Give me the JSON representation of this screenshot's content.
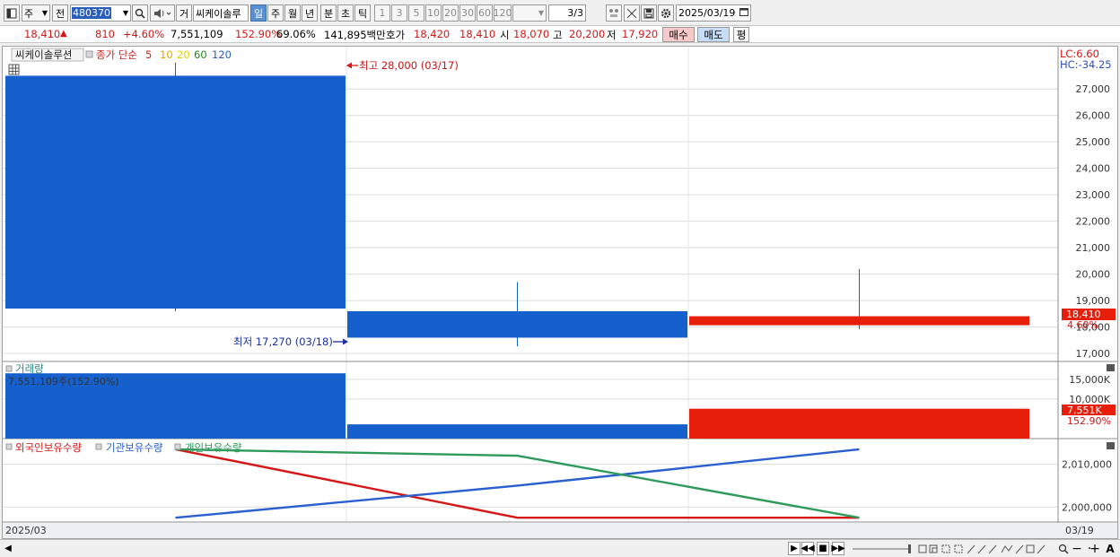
{
  "toolbar": {
    "market_label": "주",
    "prev_label": "전",
    "code": "480370",
    "geo_label": "거",
    "stock_name": "씨케이솔루",
    "periods": [
      "일",
      "주",
      "월",
      "년",
      "분",
      "초",
      "틱"
    ],
    "active_period": "일",
    "intervals": [
      "1",
      "3",
      "5",
      "10",
      "20",
      "30",
      "60",
      "120"
    ],
    "page": "3/3",
    "date": "2025/03/19"
  },
  "quote": {
    "price": "18,410",
    "change": "810",
    "change_pct": "+4.60%",
    "volume": "7,551,109",
    "vol_ratio": "152.90%",
    "turnover": "69.06%",
    "amount": "141,895백만",
    "hoga_label": "호가",
    "ask": "18,420",
    "bid": "18,410",
    "open_label": "시",
    "open": "18,070",
    "high_label": "고",
    "high": "20,200",
    "low_label": "저",
    "low": "17,920",
    "buy_label": "매수",
    "sell_label": "매도",
    "avg_label": "평"
  },
  "chart_data": {
    "type": "candlestick",
    "title": "씨케이솔루션",
    "ma_label": "종가 단순",
    "ma_periods": [
      {
        "period": "5",
        "color": "#cc2222"
      },
      {
        "period": "10",
        "color": "#e0a800"
      },
      {
        "period": "20",
        "color": "#e0d000"
      },
      {
        "period": "60",
        "color": "#228822"
      },
      {
        "period": "120",
        "color": "#2a60b0"
      }
    ],
    "candles": [
      {
        "date": "03/17",
        "open": 27500,
        "high": 28000,
        "low": 18600,
        "close": 18700,
        "color": "#1560cc"
      },
      {
        "date": "03/18",
        "open": 18600,
        "high": 19700,
        "low": 17270,
        "close": 17600,
        "color": "#1560cc"
      },
      {
        "date": "03/19",
        "open": 18070,
        "high": 20200,
        "low": 17920,
        "close": 18410,
        "color": "#e61e0a"
      }
    ],
    "high_annotation": "최고 28,000 (03/17)",
    "low_annotation": "최저 17,270 (03/18)",
    "y_ticks": [
      "17,000",
      "18,000",
      "19,000",
      "20,000",
      "21,000",
      "22,000",
      "23,000",
      "24,000",
      "25,000",
      "26,000",
      "27,000"
    ],
    "y_range": [
      16700,
      28600
    ],
    "lc": "LC:6.60",
    "hc": "HC:-34.25",
    "last_price_label": "18,410",
    "last_pct_label": "4.60%",
    "volume": {
      "title": "거래량",
      "info": "7,551,109주(152.90%)",
      "values": [
        16500000,
        3600000,
        7551109
      ],
      "colors": [
        "#1560cc",
        "#1560cc",
        "#e61e0a"
      ],
      "y_ticks": [
        "10,000K",
        "15,000K"
      ],
      "y_range": [
        0,
        17000000
      ],
      "last_label": "7,551K",
      "last_pct": "152.90%"
    },
    "holdings": {
      "series": [
        {
          "name": "외국인보유수량",
          "color": "#d41616",
          "values": [
            2013500,
            1997500,
            1997500
          ]
        },
        {
          "name": "기관보유수량",
          "color": "#2a5fd0",
          "values": [
            1997500,
            2005000,
            2013500
          ]
        },
        {
          "name": "개인보유수량",
          "color": "#2e9a5a",
          "values": [
            2013500,
            2012000,
            1997500
          ]
        }
      ],
      "y_ticks": [
        "2,000,000",
        "2,010,000"
      ],
      "y_range": [
        1996500,
        2016000
      ]
    },
    "x_left_label": "2025/03",
    "x_right_label": "03/19"
  }
}
